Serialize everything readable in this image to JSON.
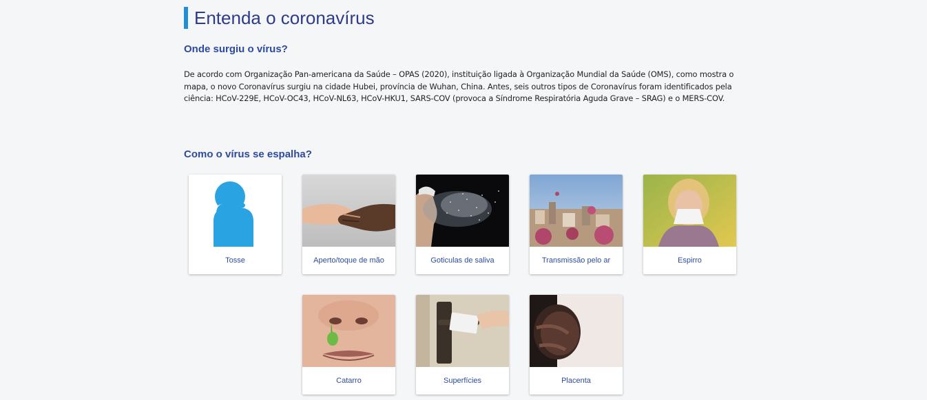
{
  "title": "Entenda o coronavírus",
  "origin": {
    "heading": "Onde surgiu o vírus?",
    "text": "De acordo com Organização Pan-americana da Saúde – OPAS (2020), instituição ligada à Organização Mundial da Saúde (OMS), como mostra o mapa, o novo Coronavírus surgiu na cidade Hubei, província de Wuhan, China. Antes, seis outros tipos de Coronavírus foram identificados pela ciência: HCoV-229E, HCoV-OC43, HCoV-NL63, HCoV-HKU1, SARS-COV (provoca a Síndrome Respiratória Aguda Grave – SRAG) e o MERS-COV."
  },
  "spread": {
    "heading": "Como o vírus se espalha?",
    "cards": [
      {
        "label": "Tosse",
        "icon": "cough-icon"
      },
      {
        "label": "Aperto/toque de mão",
        "icon": "handshake-image"
      },
      {
        "label": "Goticulas de saliva",
        "icon": "saliva-droplets-image"
      },
      {
        "label": "Transmissão pelo ar",
        "icon": "airborne-city-image"
      },
      {
        "label": "Espirro",
        "icon": "sneeze-image"
      },
      {
        "label": "Catarro",
        "icon": "mucus-image"
      },
      {
        "label": "Superfícies",
        "icon": "door-handle-image"
      },
      {
        "label": "Placenta",
        "icon": "pregnancy-image"
      }
    ]
  },
  "colors": {
    "accent": "#1e90d6",
    "heading": "#2e4a9e",
    "title": "#2e3a8c"
  }
}
